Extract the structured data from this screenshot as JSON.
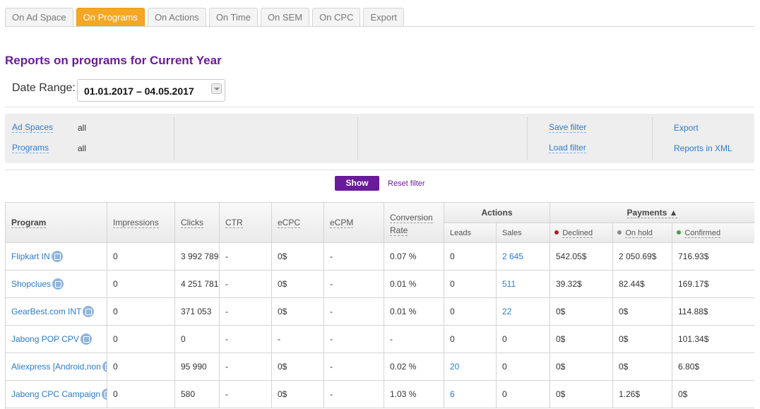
{
  "tabs": [
    {
      "label": "On Ad Space",
      "active": false
    },
    {
      "label": "On Programs",
      "active": true
    },
    {
      "label": "On Actions",
      "active": false
    },
    {
      "label": "On Time",
      "active": false
    },
    {
      "label": "On SEM",
      "active": false
    },
    {
      "label": "On CPC",
      "active": false
    },
    {
      "label": "Export",
      "active": false
    }
  ],
  "title": "Reports on programs for Current Year",
  "date_range": {
    "label": "Date Range:",
    "value": "01.01.2017  –  04.05.2017"
  },
  "filters": {
    "ad_spaces": {
      "label": "Ad Spaces",
      "value": "all"
    },
    "programs": {
      "label": "Programs",
      "value": "all"
    },
    "save_filter": "Save filter",
    "load_filter": "Load filter",
    "export": "Export",
    "reports_xml": "Reports in XML"
  },
  "buttons": {
    "show": "Show",
    "reset": "Reset filter"
  },
  "table": {
    "headers": {
      "program": "Program",
      "impressions": "Impressions",
      "clicks": "Clicks",
      "ctr": "CTR",
      "ecpc": "eCPC",
      "ecpm": "eCPM",
      "conversion": "Conversion Rate",
      "actions": "Actions",
      "leads": "Leads",
      "sales": "Sales",
      "payments": "Payments ▲",
      "declined": "Declined",
      "onhold": "On hold",
      "confirmed": "Confirmed"
    },
    "status_colors": {
      "declined": "#b71c1c",
      "onhold": "#8a8a8a",
      "confirmed": "#43a047"
    },
    "rows": [
      {
        "program": "Flipkart IN",
        "impressions": "0",
        "clicks": "3 992 789",
        "ctr": "-",
        "ecpc": "0$",
        "ecpm": "-",
        "conversion": "0.07 %",
        "leads": "0",
        "sales": "2 645",
        "declined": "542.05$",
        "onhold": "2 050.69$",
        "confirmed": "716.93$"
      },
      {
        "program": "Shopclues",
        "impressions": "0",
        "clicks": "4 251 781",
        "ctr": "-",
        "ecpc": "0$",
        "ecpm": "-",
        "conversion": "0.01 %",
        "leads": "0",
        "sales": "511",
        "declined": "39.32$",
        "onhold": "82.44$",
        "confirmed": "169.17$"
      },
      {
        "program": "GearBest.com INT",
        "impressions": "0",
        "clicks": "371 053",
        "ctr": "-",
        "ecpc": "0$",
        "ecpm": "-",
        "conversion": "0.01 %",
        "leads": "0",
        "sales": "22",
        "declined": "0$",
        "onhold": "0$",
        "confirmed": "114.88$"
      },
      {
        "program": "Jabong POP CPV",
        "impressions": "0",
        "clicks": "0",
        "ctr": "-",
        "ecpc": "-",
        "ecpm": "-",
        "conversion": "-",
        "leads": "0",
        "sales": "0",
        "declined": "0$",
        "onhold": "0$",
        "confirmed": "101.34$"
      },
      {
        "program": "Aliexpress [Android,non",
        "impressions": "0",
        "clicks": "95 990",
        "ctr": "-",
        "ecpc": "0$",
        "ecpm": "-",
        "conversion": "0.02 %",
        "leads": "20",
        "sales": "0",
        "declined": "0$",
        "onhold": "0$",
        "confirmed": "6.80$"
      },
      {
        "program": "Jabong CPC Campaign",
        "impressions": "0",
        "clicks": "580",
        "ctr": "-",
        "ecpc": "0$",
        "ecpm": "-",
        "conversion": "1.03 %",
        "leads": "6",
        "sales": "0",
        "declined": "0$",
        "onhold": "1.26$",
        "confirmed": "0$"
      }
    ]
  }
}
